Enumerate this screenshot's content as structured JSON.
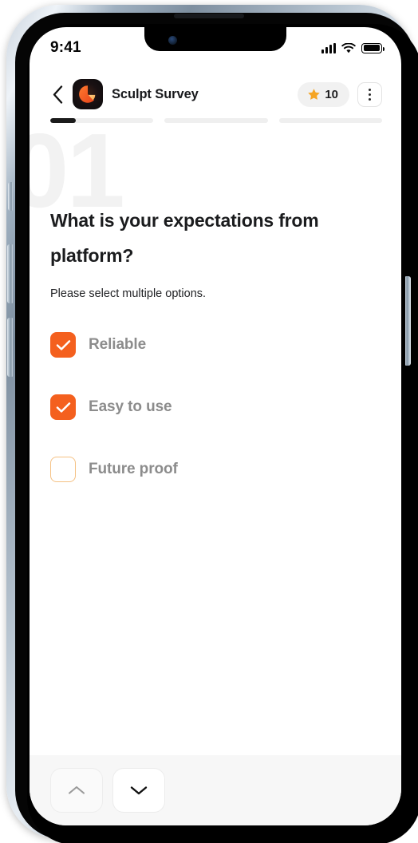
{
  "status_bar": {
    "time": "9:41",
    "signal_icon": "cellular-signal-icon",
    "wifi_icon": "wifi-icon",
    "battery_icon": "battery-full-icon"
  },
  "header": {
    "back_icon": "chevron-left-icon",
    "logo_icon": "sculpt-app-logo",
    "title": "Sculpt Survey",
    "score": {
      "star_icon": "star-icon",
      "value": "10"
    },
    "menu_icon": "more-vertical-icon"
  },
  "progress": {
    "segments": [
      {
        "fill_percent": 25
      },
      {
        "fill_percent": 0
      },
      {
        "fill_percent": 0
      }
    ],
    "active_color": "#1b1b1b",
    "track_color": "#efefef"
  },
  "question": {
    "number_watermark": "01",
    "text": "What is your expectations from platform?",
    "subtitle": "Please select multiple options."
  },
  "options": [
    {
      "label": "Reliable",
      "checked": true,
      "check_icon": "checkmark-icon"
    },
    {
      "label": "Easy to use",
      "checked": true,
      "check_icon": "checkmark-icon"
    },
    {
      "label": "Future proof",
      "checked": false,
      "check_icon": "checkmark-icon"
    }
  ],
  "bottom_nav": {
    "prev_icon": "chevron-up-icon",
    "next_icon": "chevron-down-icon",
    "prev_enabled": false,
    "next_enabled": true
  },
  "colors": {
    "accent": "#f4601e",
    "accent_soft": "#f5c183",
    "star": "#f5a524",
    "text_dark": "#1b1c1e",
    "text_muted": "#8c8c8c",
    "watermark": "#f2f2f2",
    "bottom_bar": "#f7f7f7"
  }
}
